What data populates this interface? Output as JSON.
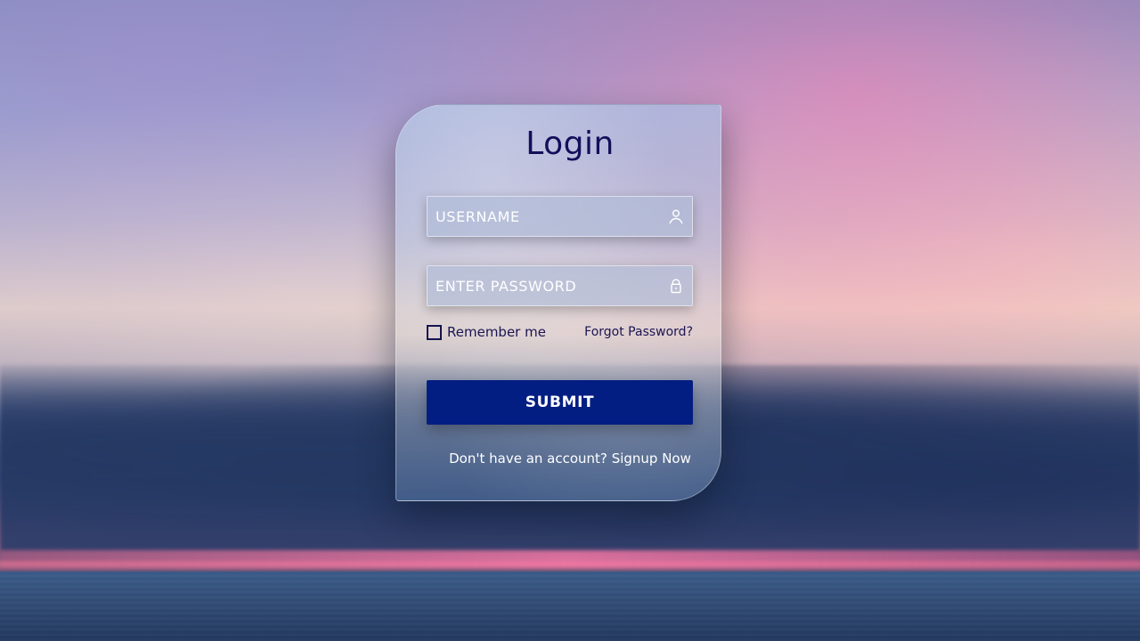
{
  "page": {
    "title": "Login"
  },
  "form": {
    "username": {
      "placeholder": "USERNAME",
      "value": "",
      "icon": "user-icon"
    },
    "password": {
      "placeholder": "ENTER PASSWORD",
      "value": "",
      "icon": "lock-icon"
    },
    "remember_label": "Remember me",
    "remember_checked": false,
    "forgot_label": "Forgot Password?",
    "submit_label": "SUBMIT"
  },
  "footer": {
    "prompt": "Don't have an account?",
    "link_label": "Signup Now"
  },
  "colors": {
    "primary": "#021e82",
    "title": "#140f5a"
  }
}
